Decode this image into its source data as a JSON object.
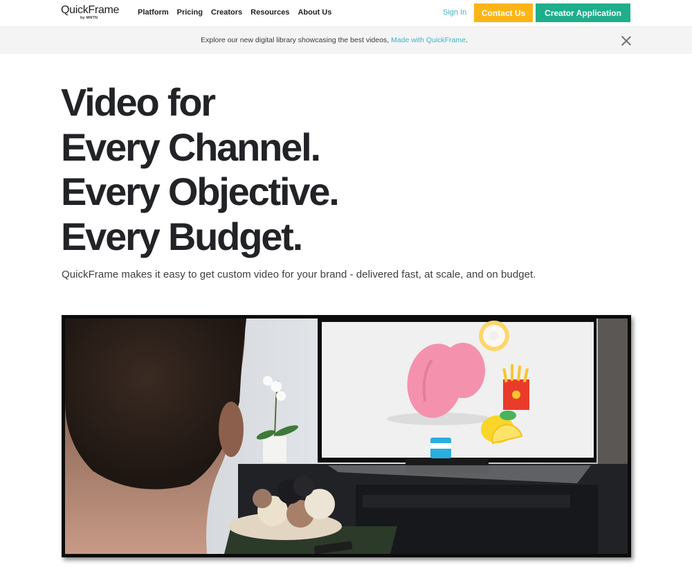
{
  "nav": {
    "logo_text": "QuickFrame",
    "logo_sub": "by MNTN",
    "links": [
      "Platform",
      "Pricing",
      "Creators",
      "Resources",
      "About Us"
    ],
    "sign_in": "Sign In",
    "contact_button": "Contact Us",
    "creator_button": "Creator Application"
  },
  "banner": {
    "text": "Explore our new digital library showcasing the best videos, ",
    "link": "Made with QuickFrame",
    "suffix": ".",
    "close_icon": "close-icon"
  },
  "hero": {
    "title_lines": [
      "Video for",
      "Every Channel.",
      "Every Objective.",
      "Every Budget."
    ],
    "subtitle": "QuickFrame makes it easy to get custom video for your brand - delivered fast, at scale, and on budget."
  },
  "video": {
    "description": "Man watching TV showing animated food icons (pink blob, donut, fries, lemon, coffee cup)"
  },
  "colors": {
    "contact_button": "#fbb516",
    "creator_button": "#1fae8b",
    "link": "#3bb3c9",
    "text_dark": "#222326",
    "banner_bg": "#f4f4f4"
  }
}
